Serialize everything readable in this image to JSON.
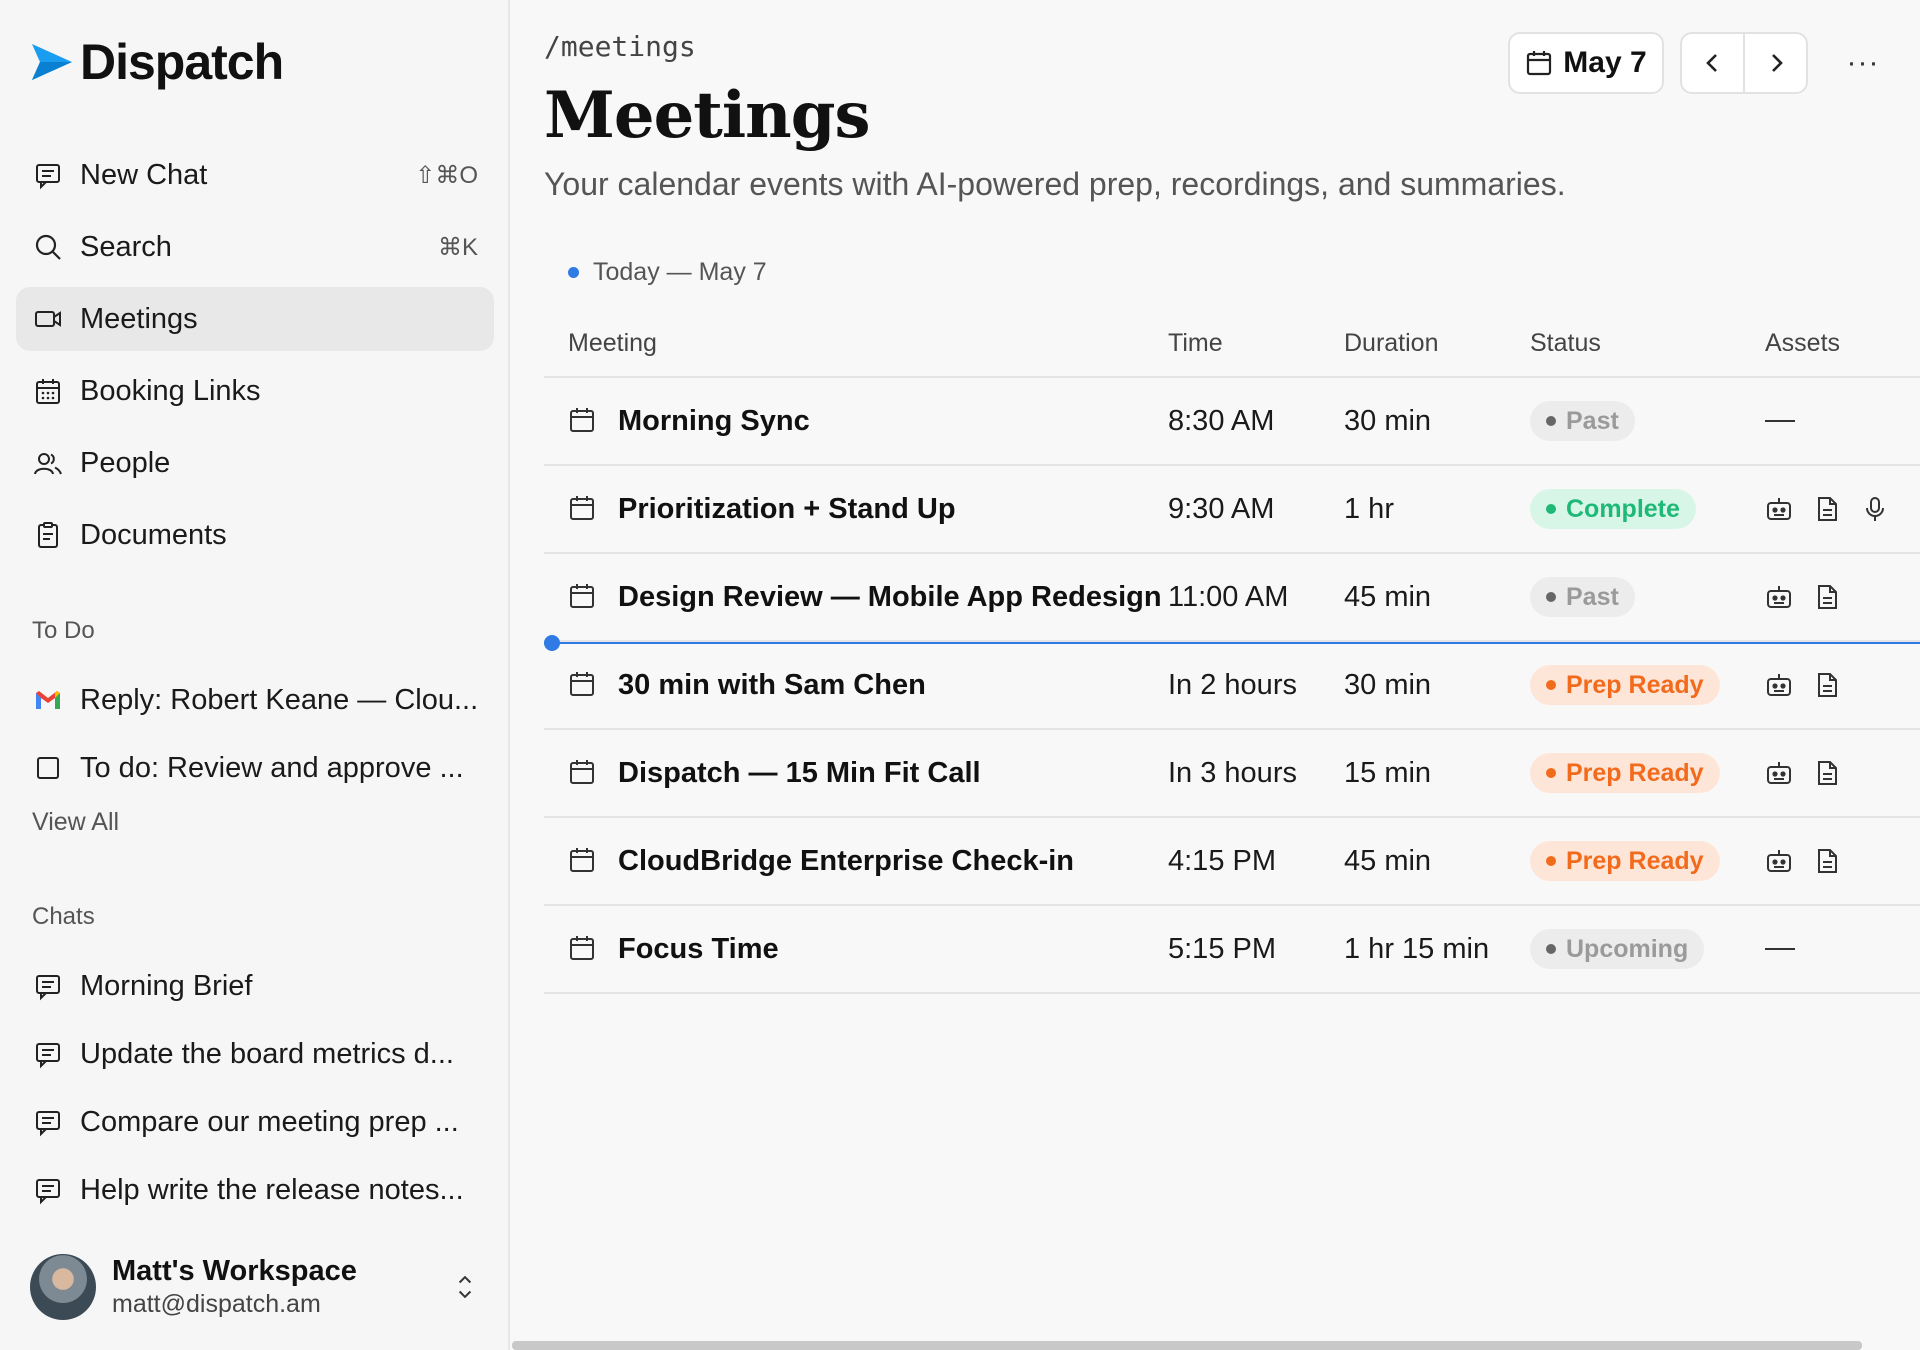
{
  "app": {
    "name": "Dispatch",
    "brand_color": "#1a9cf0"
  },
  "sidebar": {
    "nav": [
      {
        "label": "New Chat",
        "shortcut": "⇧⌘O",
        "icon": "chat-icon"
      },
      {
        "label": "Search",
        "shortcut": "⌘K",
        "icon": "search-icon"
      },
      {
        "label": "Meetings",
        "shortcut": "",
        "icon": "video-icon",
        "active": true
      },
      {
        "label": "Booking Links",
        "shortcut": "",
        "icon": "calendar-grid-icon"
      },
      {
        "label": "People",
        "shortcut": "",
        "icon": "people-icon"
      },
      {
        "label": "Documents",
        "shortcut": "",
        "icon": "document-icon"
      }
    ],
    "todo": {
      "label": "To Do",
      "items": [
        {
          "label": "Reply: Robert Keane — Clou...",
          "icon": "gmail-icon"
        },
        {
          "label": "To do: Review and approve ...",
          "icon": "checkbox-icon"
        }
      ],
      "view_all": "View All"
    },
    "chats": {
      "label": "Chats",
      "items": [
        {
          "label": "Morning Brief"
        },
        {
          "label": "Update the board metrics d..."
        },
        {
          "label": "Compare our meeting prep ..."
        },
        {
          "label": "Help write the release notes..."
        }
      ]
    },
    "workspace": {
      "name": "Matt's Workspace",
      "email": "matt@dispatch.am"
    }
  },
  "main": {
    "path": "/meetings",
    "title": "Meetings",
    "subtitle": "Your calendar events with AI-powered prep, recordings, and summaries.",
    "date_button": "May 7",
    "more": "···",
    "today_label": "Today — May 7",
    "columns": {
      "meeting": "Meeting",
      "time": "Time",
      "duration": "Duration",
      "status": "Status",
      "assets": "Assets"
    },
    "meetings": [
      {
        "title": "Morning Sync",
        "time": "8:30 AM",
        "duration": "30 min",
        "status": "Past",
        "assets": []
      },
      {
        "title": "Prioritization + Stand Up",
        "time": "9:30 AM",
        "duration": "1 hr",
        "status": "Complete",
        "assets": [
          "bot-icon",
          "doc-icon",
          "mic-icon"
        ]
      },
      {
        "title": "Design Review — Mobile App Redesign",
        "time": "11:00 AM",
        "duration": "45 min",
        "status": "Past",
        "assets": [
          "bot-icon",
          "doc-icon"
        ]
      },
      {
        "title": "30 min with Sam Chen",
        "time": "In 2 hours",
        "duration": "30 min",
        "status": "Prep Ready",
        "assets": [
          "bot-icon",
          "doc-icon"
        ]
      },
      {
        "title": "Dispatch — 15 Min Fit Call",
        "time": "In 3 hours",
        "duration": "15 min",
        "status": "Prep Ready",
        "assets": [
          "bot-icon",
          "doc-icon"
        ]
      },
      {
        "title": "CloudBridge Enterprise Check-in",
        "time": "4:15 PM",
        "duration": "45 min",
        "status": "Prep Ready",
        "assets": [
          "bot-icon",
          "doc-icon"
        ]
      },
      {
        "title": "Focus Time",
        "time": "5:15 PM",
        "duration": "1 hr 15 min",
        "status": "Upcoming",
        "assets": []
      }
    ],
    "status_colors": {
      "Past": {
        "bg": "#ececec",
        "fg": "#9a9a9a",
        "dot": "#666666"
      },
      "Complete": {
        "bg": "#d8f6e8",
        "fg": "#1fb977",
        "dot": "#1fb977"
      },
      "Prep Ready": {
        "bg": "#fde6d7",
        "fg": "#f26b1d",
        "dot": "#f26b1d"
      },
      "Upcoming": {
        "bg": "#ececec",
        "fg": "#9a9a9a",
        "dot": "#666666"
      }
    },
    "now_indicator_color": "#2f7ae5"
  }
}
